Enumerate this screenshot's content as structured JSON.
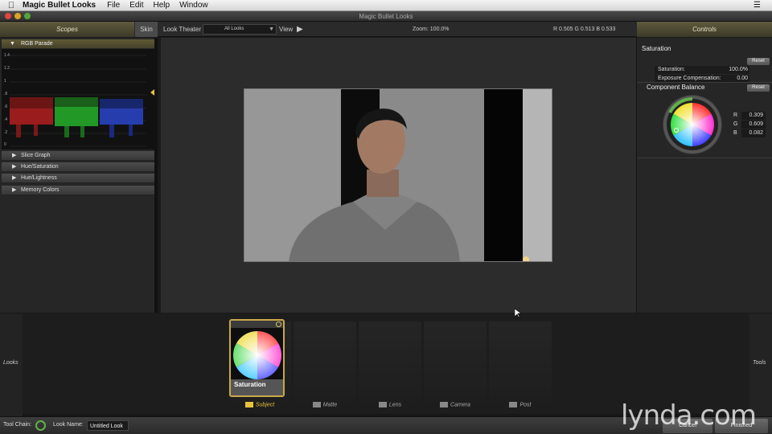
{
  "menubar": {
    "app_name": "Magic Bullet Looks",
    "items": [
      "File",
      "Edit",
      "Help",
      "Window"
    ],
    "right_icon": "menu-extra-icon"
  },
  "window": {
    "title": "Magic Bullet Looks"
  },
  "toolbar": {
    "scopes_tab": "Scopes",
    "skin_button": "Skin",
    "look_theater_label": "Look Theater",
    "looks_select_value": "All Looks",
    "view_label": "View",
    "zoom_text": "Zoom:  100.0%",
    "rgb_readout": "R  0.505    G  0.513    B  0.533",
    "controls_tab": "Controls"
  },
  "scopes": {
    "rgb_parade_label": "RGB Parade",
    "y_ticks": [
      "1.4",
      "1.2",
      "1",
      ".8",
      ".6",
      ".4",
      ".2",
      "0"
    ],
    "accordions": [
      "Slice Graph",
      "Hue/Saturation",
      "Hue/Lightness",
      "Memory Colors"
    ]
  },
  "controls": {
    "section_title": "Saturation",
    "reset_label": "Reset",
    "rows": [
      {
        "label": "Saturation:",
        "value": "100.0%"
      },
      {
        "label": "Exposure Compensation:",
        "value": "0.00"
      }
    ],
    "component_balance_title": "Component Balance",
    "rgb_values": [
      {
        "label": "R",
        "value": "0.309"
      },
      {
        "label": "G",
        "value": "0.609"
      },
      {
        "label": "B",
        "value": "0.082"
      }
    ]
  },
  "bottom": {
    "looks_tab": "Looks",
    "tools_tab": "Tools",
    "stages": [
      "Subject",
      "Matte",
      "Lens",
      "Camera",
      "Post"
    ],
    "active_tool_card": "Saturation"
  },
  "status": {
    "tool_chain_label": "Tool Chain:",
    "look_name_label": "Look Name:",
    "look_name_value": "Untitled Look",
    "cancel_label": "Cancel",
    "finished_label": "Finished"
  },
  "watermark": "lynda.com",
  "colors": {
    "accent_gold": "#c9a84a",
    "power_green": "#62b14a",
    "tab_olive": "#5e5a3e"
  }
}
